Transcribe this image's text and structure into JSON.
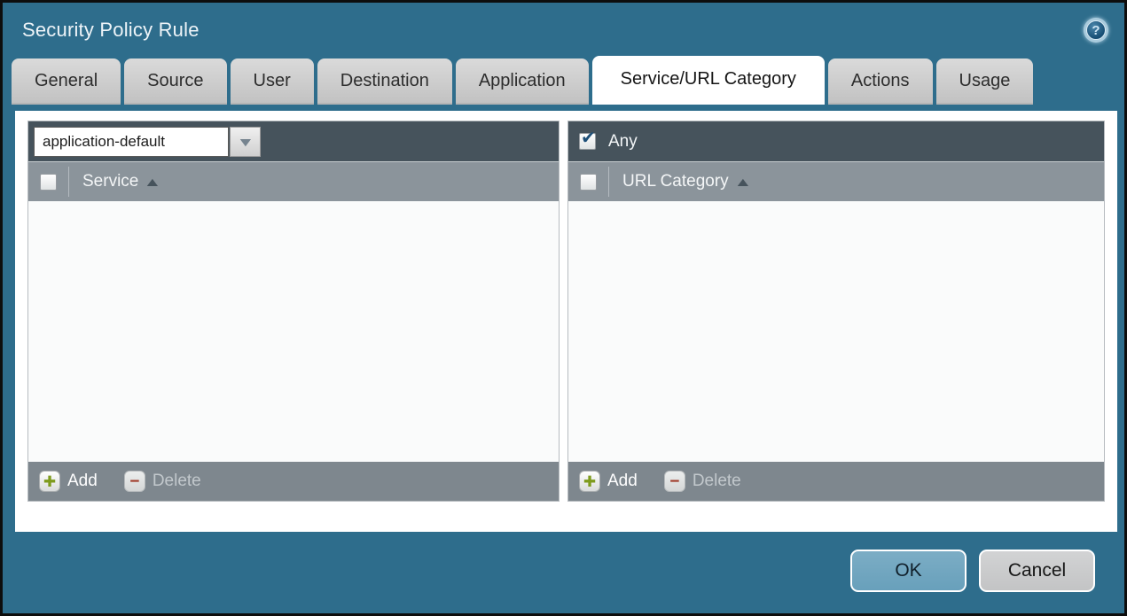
{
  "titlebar": {
    "title": "Security Policy Rule",
    "help_icon_glyph": "?"
  },
  "tabs": [
    {
      "label": "General",
      "active": false
    },
    {
      "label": "Source",
      "active": false
    },
    {
      "label": "User",
      "active": false
    },
    {
      "label": "Destination",
      "active": false
    },
    {
      "label": "Application",
      "active": false
    },
    {
      "label": "Service/URL Category",
      "active": true
    },
    {
      "label": "Actions",
      "active": false
    },
    {
      "label": "Usage",
      "active": false
    }
  ],
  "service_panel": {
    "service_dropdown": {
      "value": "application-default",
      "arrow_glyph": "▼"
    },
    "header": {
      "label": "Service",
      "sort_glyph": "▲",
      "select_all_checked": false
    },
    "rows": [],
    "footer": {
      "add_label": "Add",
      "delete_label": "Delete",
      "add_glyph": "✚",
      "delete_glyph": "−",
      "delete_enabled": false
    }
  },
  "url_category_panel": {
    "any_checkbox": {
      "label": "Any",
      "checked": true,
      "check_glyph": "✔"
    },
    "header": {
      "label": "URL Category",
      "sort_glyph": "▲",
      "select_all_checked": false
    },
    "rows": [],
    "footer": {
      "add_label": "Add",
      "delete_label": "Delete",
      "add_glyph": "✚",
      "delete_glyph": "−",
      "delete_enabled": false
    }
  },
  "dialog_buttons": {
    "ok_label": "OK",
    "cancel_label": "Cancel"
  },
  "colors": {
    "teal_bg": "#2e6d8c",
    "panel_topbar": "#46535c",
    "column_header": "#8b949b",
    "panel_footer": "#7e878e",
    "ok_button": "#68a0bb",
    "ok_button_light": "#7cadc5",
    "check_navy": "#1d4f78",
    "add_green": "#7e9b1d",
    "delete_red": "#a03a28"
  }
}
